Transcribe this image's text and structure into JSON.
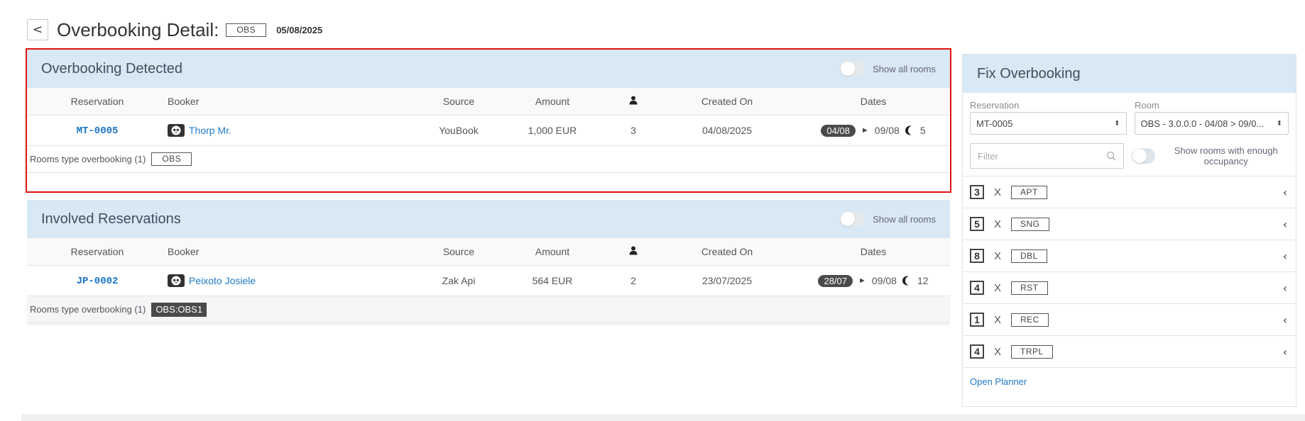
{
  "title": {
    "back_glyph": "<",
    "text": "Overbooking Detail:",
    "tag": "OBS",
    "date": "05/08/2025"
  },
  "overbooking_panel": {
    "title": "Overbooking Detected",
    "toggle_label": "Show all rooms",
    "columns": [
      "Reservation",
      "Booker",
      "Source",
      "Amount",
      "guests-icon",
      "Created On",
      "Dates"
    ],
    "row": {
      "reservation": "MT-0005",
      "booker": "Thorp Mr.",
      "source": "YouBook",
      "amount": "1,000 EUR",
      "guests": "3",
      "created_on": "04/08/2025",
      "date_from": "04/08",
      "date_to": "09/08",
      "nights": "5"
    },
    "footer_label": "Rooms type overbooking (1)",
    "footer_tag": "OBS"
  },
  "involved_panel": {
    "title": "Involved Reservations",
    "toggle_label": "Show all rooms",
    "columns": [
      "Reservation",
      "Booker",
      "Source",
      "Amount",
      "guests-icon",
      "Created On",
      "Dates"
    ],
    "row": {
      "reservation": "JP-0002",
      "booker": "Peixoto Josiele",
      "source": "Zak Api",
      "amount": "564 EUR",
      "guests": "2",
      "created_on": "23/07/2025",
      "date_from": "28/07",
      "date_to": "09/08",
      "nights": "12"
    },
    "footer_label": "Rooms type overbooking (1)",
    "footer_tag": "OBS:OBS1"
  },
  "fix_panel": {
    "title": "Fix Overbooking",
    "reservation_label": "Reservation",
    "room_label": "Room",
    "reservation_value": "MT-0005",
    "room_value": "OBS - 3.0.0.0 - 04/08 > 09/0...",
    "filter_placeholder": "Filter",
    "toggle_label": "Show rooms with enough occupancy",
    "rooms": [
      {
        "count": "3",
        "x": "X",
        "type": "APT"
      },
      {
        "count": "5",
        "x": "X",
        "type": "SNG"
      },
      {
        "count": "8",
        "x": "X",
        "type": "DBL"
      },
      {
        "count": "4",
        "x": "X",
        "type": "RST"
      },
      {
        "count": "1",
        "x": "X",
        "type": "REC"
      },
      {
        "count": "4",
        "x": "X",
        "type": "TRPL"
      }
    ],
    "open_planner": "Open Planner"
  },
  "colors": {
    "panel_header": "#d8e8f5",
    "link": "#1f7ac8",
    "highlight_border": "#e01010",
    "pill": "#4a4a4a"
  }
}
